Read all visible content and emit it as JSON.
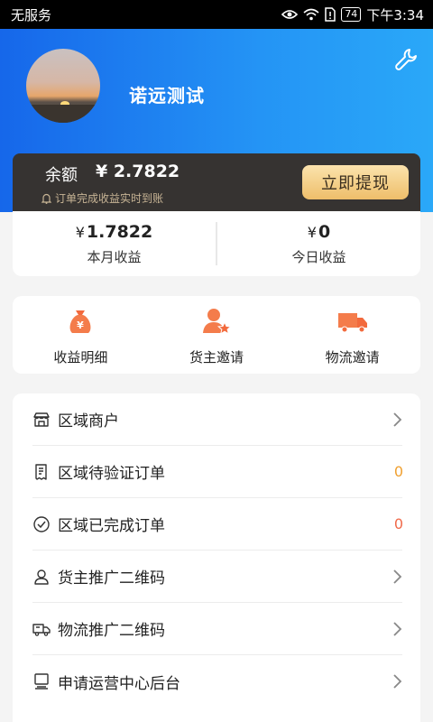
{
  "status_bar": {
    "carrier": "无服务",
    "battery": "74",
    "time": "下午3:34"
  },
  "profile": {
    "name": "诺远测试"
  },
  "balance": {
    "label": "余额",
    "value": "¥ 2.7822",
    "note": "订单完成收益实时到账",
    "withdraw_label": "立即提现"
  },
  "earnings": [
    {
      "currency": "¥",
      "value": "1.7822",
      "label": "本月收益"
    },
    {
      "currency": "¥",
      "value": "0",
      "label": "今日收益"
    }
  ],
  "quick_actions": [
    {
      "label": "收益明细",
      "icon": "money-bag-icon"
    },
    {
      "label": "货主邀请",
      "icon": "user-star-icon"
    },
    {
      "label": "物流邀请",
      "icon": "truck-icon"
    }
  ],
  "menu": [
    {
      "label": "区域商户",
      "icon": "store-icon"
    },
    {
      "label": "区域待验证订单",
      "icon": "receipt-icon",
      "count": "0",
      "count_color": "#f0a030"
    },
    {
      "label": "区域已完成订单",
      "icon": "check-circle-icon",
      "count": "0",
      "count_color": "#f06a4a"
    },
    {
      "label": "货主推广二维码",
      "icon": "user-icon"
    },
    {
      "label": "物流推广二维码",
      "icon": "truck-outline-icon"
    },
    {
      "label": "申请运营中心后台",
      "icon": "monitor-icon"
    }
  ],
  "colors": {
    "brand_blue": "#1e7ff0",
    "dark_card": "#363331",
    "gold": "#eebe6a",
    "accent_orange": "#f06a4a"
  }
}
